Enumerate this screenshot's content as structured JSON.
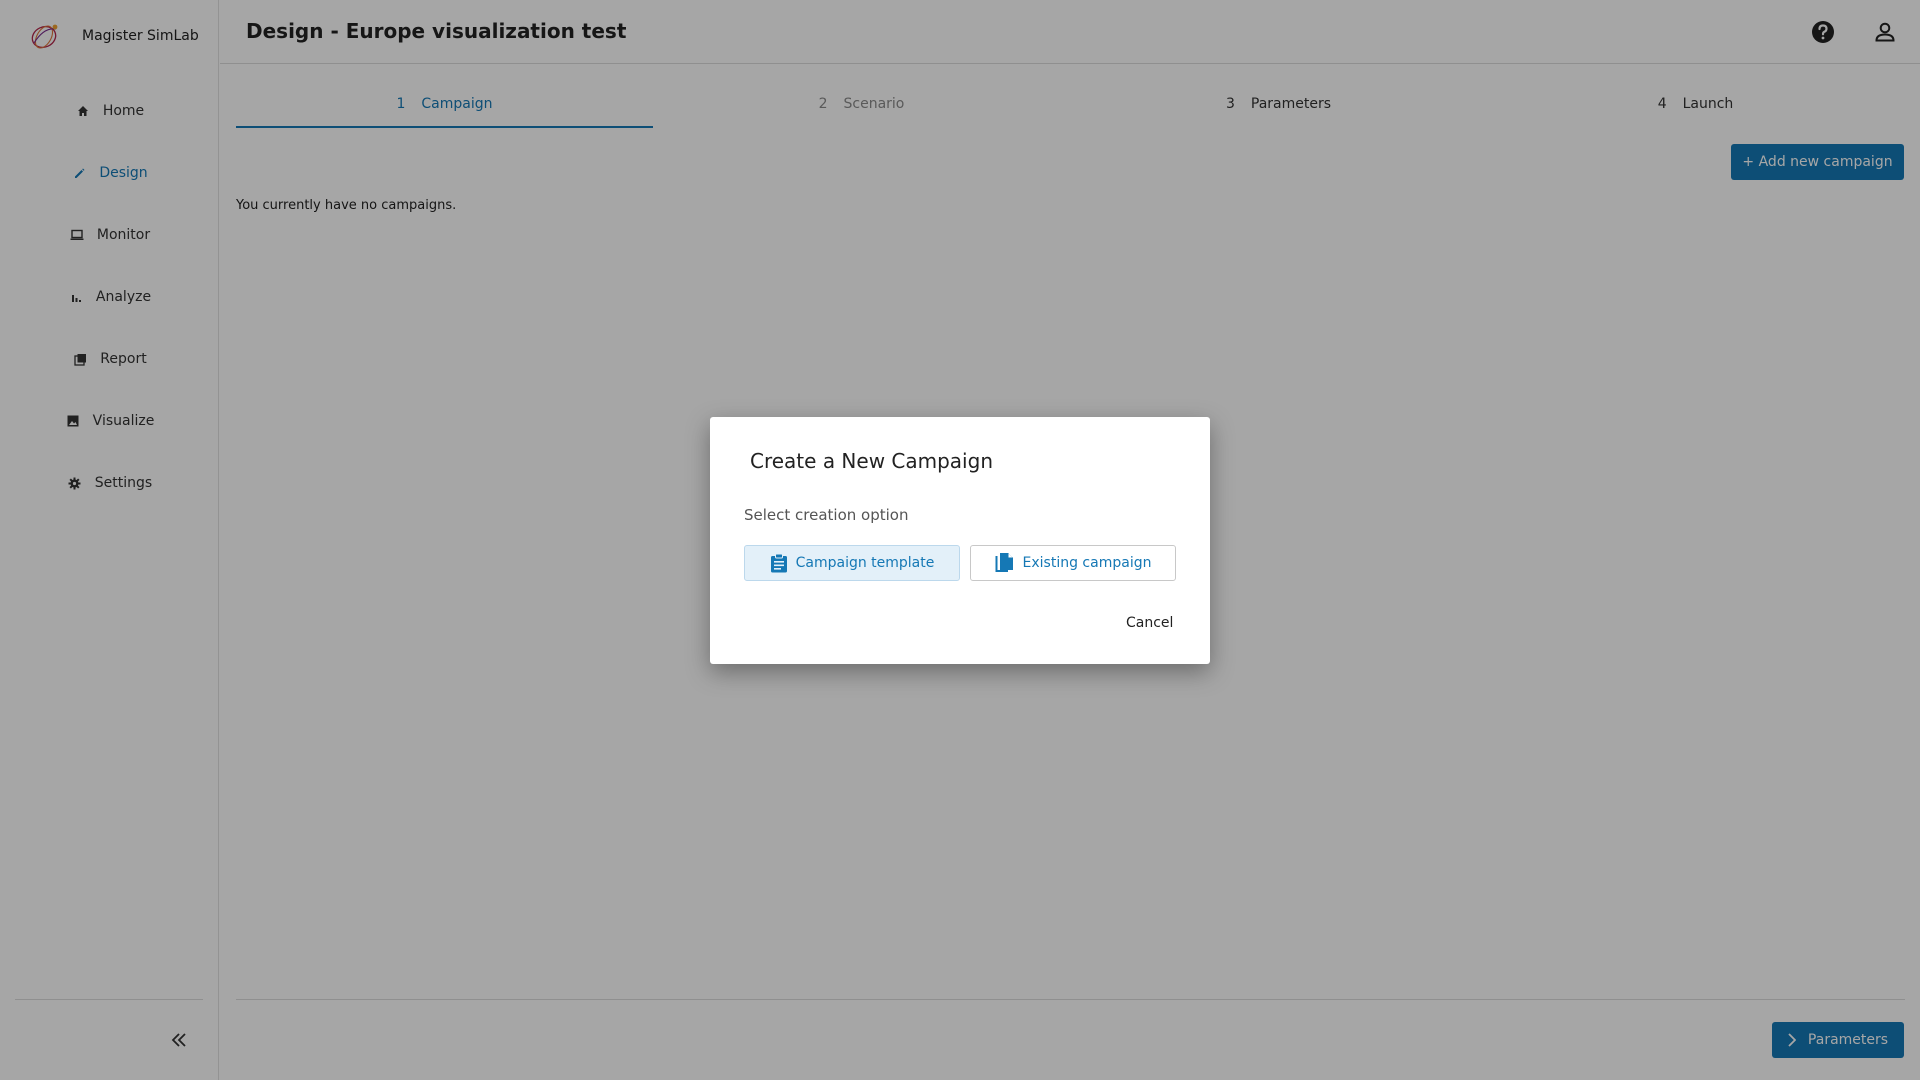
{
  "app": {
    "name": "Magister SimLab"
  },
  "header": {
    "title": "Design - Europe visualization test"
  },
  "sidebar": {
    "items": [
      {
        "label": "Home",
        "icon": "home-icon"
      },
      {
        "label": "Design",
        "icon": "pencil-icon",
        "active": true
      },
      {
        "label": "Monitor",
        "icon": "monitor-icon"
      },
      {
        "label": "Analyze",
        "icon": "bar-chart-icon"
      },
      {
        "label": "Report",
        "icon": "report-icon"
      },
      {
        "label": "Visualize",
        "icon": "image-icon"
      },
      {
        "label": "Settings",
        "icon": "gear-icon"
      }
    ]
  },
  "stepper": {
    "steps": [
      {
        "num": "1",
        "label": "Campaign",
        "state": "active"
      },
      {
        "num": "2",
        "label": "Scenario",
        "state": "disabled"
      },
      {
        "num": "3",
        "label": "Parameters",
        "state": "normal"
      },
      {
        "num": "4",
        "label": "Launch",
        "state": "normal"
      }
    ]
  },
  "main": {
    "add_button_label": "+ Add new campaign",
    "empty_message": "You currently have no campaigns."
  },
  "footer": {
    "next_button_label": "Parameters"
  },
  "dialog": {
    "title": "Create a New Campaign",
    "subtitle": "Select creation option",
    "option_template_label": "Campaign template",
    "option_existing_label": "Existing campaign",
    "cancel_label": "Cancel"
  },
  "colors": {
    "accent": "#1578b5",
    "overlay": "rgba(0,0,0,0.35)"
  }
}
